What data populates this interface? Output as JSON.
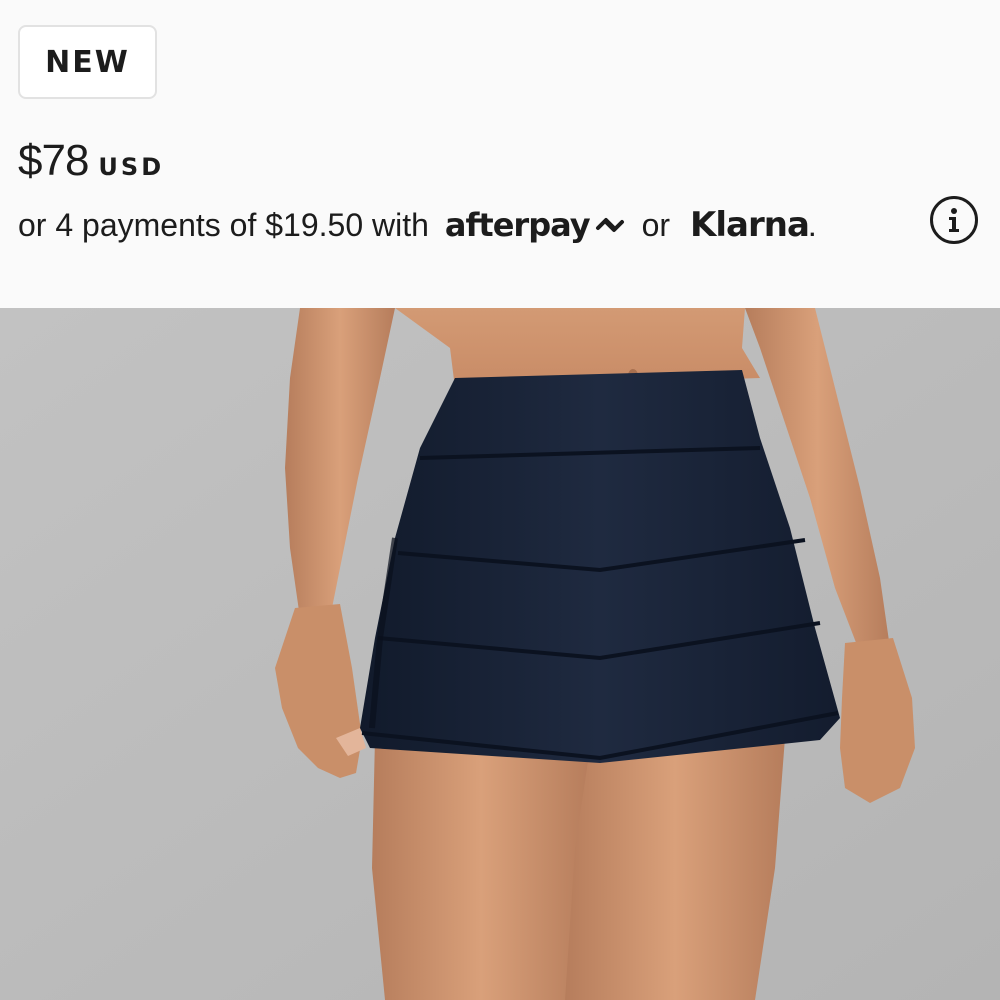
{
  "product": {
    "badge": "NEW",
    "price": {
      "amount": "$78",
      "currency": "USD"
    },
    "installments": {
      "text": "or 4 payments of $19.50 with",
      "provider_1": "afterpay",
      "separator": "or",
      "provider_2": "Klarna",
      "provider_2_suffix": "."
    },
    "info_icon": "info-circle-icon",
    "image": {
      "subject": "navy pleated mini skirt",
      "background_color": "#bcbcbc",
      "garment_color": "#1a2438"
    }
  }
}
